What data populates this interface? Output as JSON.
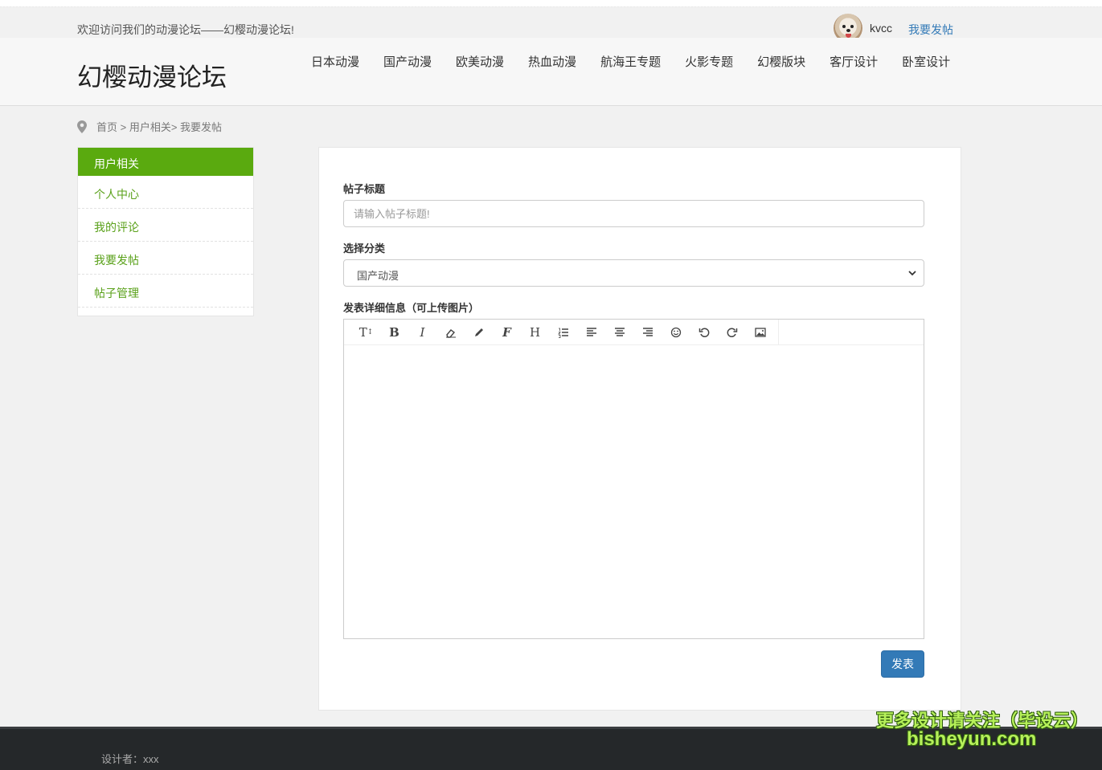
{
  "topbar": {
    "welcome": "欢迎访问我们的动漫论坛——幻樱动漫论坛!",
    "username": "kvcc",
    "post_link": "我要发帖"
  },
  "header": {
    "site_title": "幻樱动漫论坛",
    "nav": [
      "日本动漫",
      "国产动漫",
      "欧美动漫",
      "热血动漫",
      "航海王专题",
      "火影专题",
      "幻樱版块",
      "客厅设计",
      "卧室设计"
    ]
  },
  "breadcrumb": "首页 > 用户相关> 我要发帖",
  "sidebar": {
    "heading": "用户相关",
    "items": [
      "个人中心",
      "我的评论",
      "我要发帖",
      "帖子管理"
    ]
  },
  "form": {
    "title_label": "帖子标题",
    "title_value": "",
    "title_placeholder": "请输入帖子标题!",
    "category_label": "选择分类",
    "category_selected": "国产动漫",
    "detail_label": "发表详细信息（可上传图片）",
    "submit_label": "发表"
  },
  "editor_tools": [
    "text-size-icon",
    "bold-icon",
    "italic-icon",
    "eraser-icon",
    "pen-icon",
    "font-icon",
    "heading-icon",
    "ordered-list-icon",
    "align-left-icon",
    "align-center-icon",
    "align-right-icon",
    "emoji-icon",
    "undo-icon",
    "redo-icon",
    "image-icon"
  ],
  "footer": {
    "designer": "设计者：xxx"
  },
  "watermark": {
    "line1": "更多设计请关注（毕设云）",
    "line2": "bisheyun.com"
  },
  "colors": {
    "accent_green": "#5aaa0f",
    "link_blue": "#337ab7",
    "footer_bg": "#25282a"
  }
}
